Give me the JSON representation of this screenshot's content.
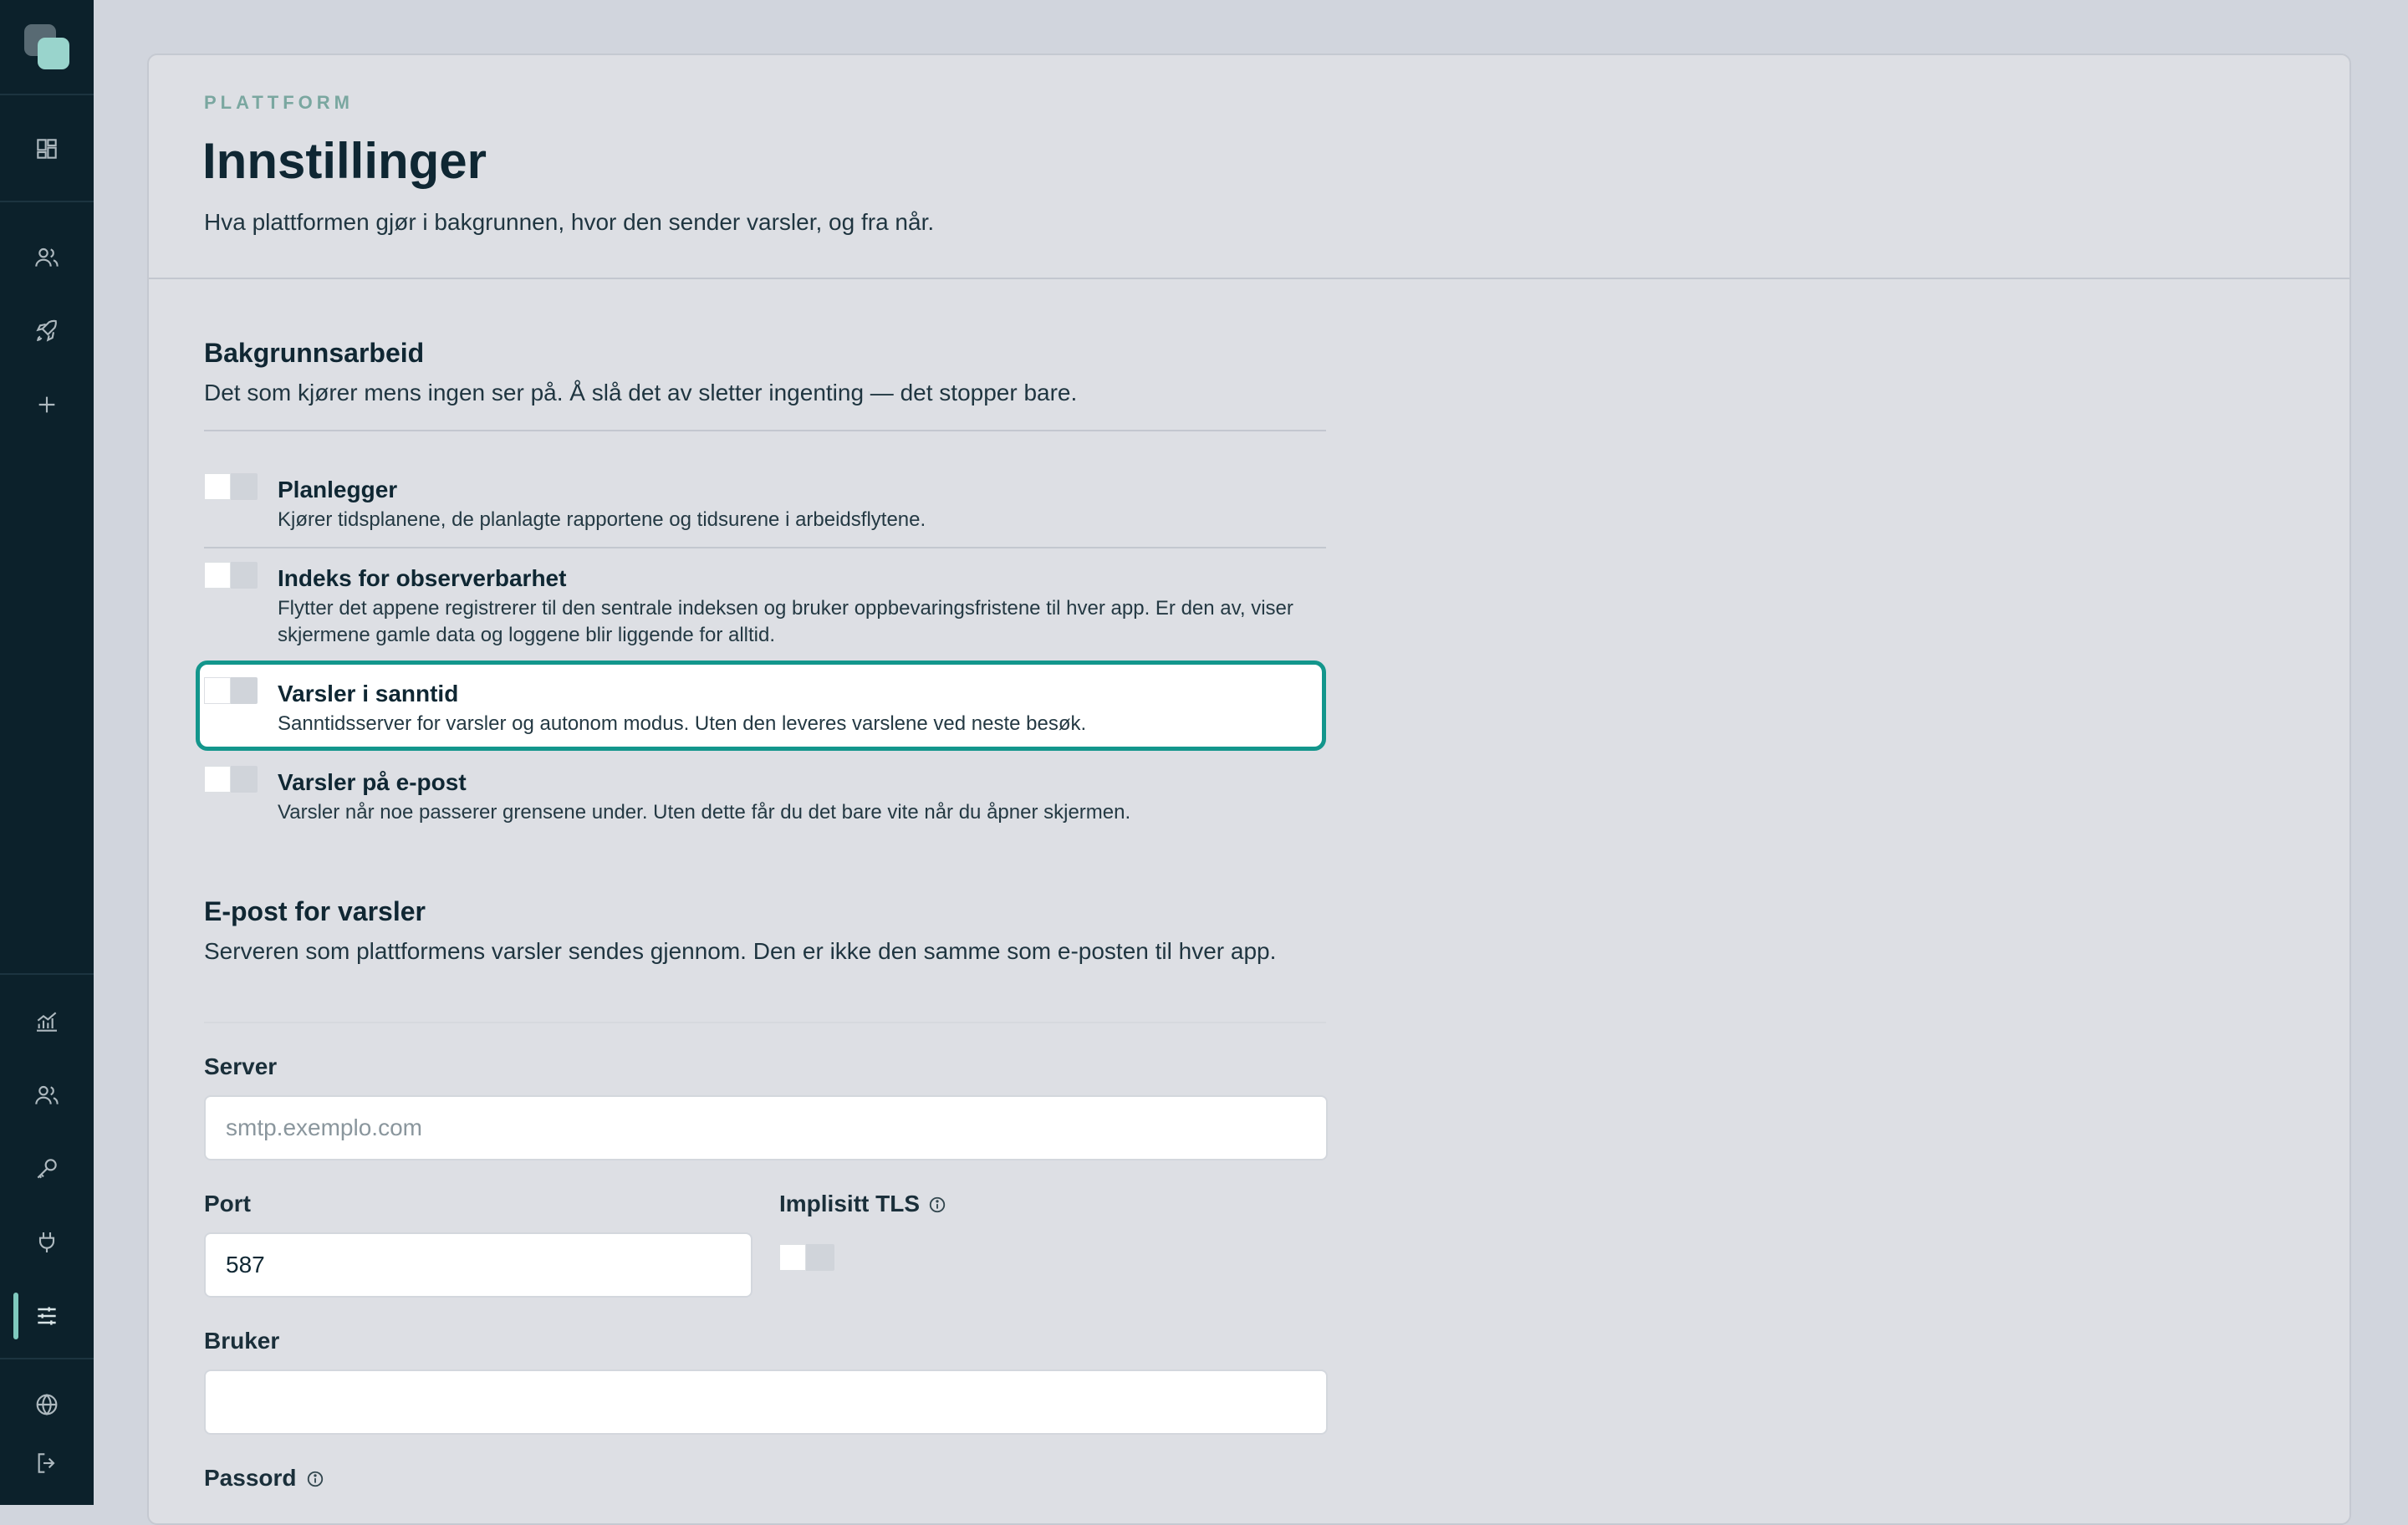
{
  "sidebar": {
    "top_icons": [
      "dashboard-icon",
      "users-icon",
      "rocket-icon",
      "plus-icon"
    ],
    "bottom_icons": [
      "chart-icon",
      "team-icon",
      "key-icon",
      "plug-icon",
      "sliders-icon",
      "globe-icon",
      "logout-icon"
    ],
    "active": "sliders-icon",
    "accent_color": "#7fc9be"
  },
  "header": {
    "eyebrow": "PLATTFORM",
    "title": "Innstillinger",
    "subtitle": "Hva plattformen gjør i bakgrunnen, hvor den sender varsler, og fra når."
  },
  "background": {
    "title": "Bakgrunnsarbeid",
    "description": "Det som kjører mens ingen ser på. Å slå det av sletter ingenting — det stopper bare.",
    "items": [
      {
        "label": "Planlegger",
        "description": "Kjører tidsplanene, de planlagte rapportene og tidsurene i arbeidsflytene.",
        "enabled": false
      },
      {
        "label": "Indeks for observerbarhet",
        "description": "Flytter det appene registrerer til den sentrale indeksen og bruker oppbevaringsfristene til hver app. Er den av, viser skjermene gamle data og loggene blir liggende for alltid.",
        "enabled": false
      },
      {
        "label": "Varsler i sanntid",
        "description": "Sanntidsserver for varsler og autonom modus. Uten den leveres varslene ved neste besøk.",
        "enabled": false
      },
      {
        "label": "Varsler på e-post",
        "description": "Varsler når noe passerer grensene under. Uten dette får du det bare vite når du åpner skjermen.",
        "enabled": false
      }
    ]
  },
  "email": {
    "title": "E-post for varsler",
    "description": "Serveren som plattformens varsler sendes gjennom. Den er ikke den samme som e-posten til hver app.",
    "server_label": "Server",
    "server_placeholder": "smtp.exemplo.com",
    "server_value": "",
    "port_label": "Port",
    "port_value": "587",
    "tls_label": "Implisitt TLS",
    "tls_enabled": false,
    "user_label": "Bruker",
    "user_value": "",
    "password_label": "Passord"
  },
  "colors": {
    "focus_ring": "#13968c",
    "sidebar_bg": "#0c212b",
    "panel_bg": "#dddfe4"
  }
}
